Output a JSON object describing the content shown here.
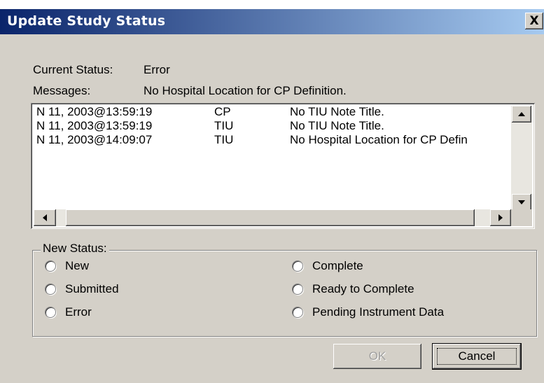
{
  "window": {
    "title": "Update Study Status",
    "close_glyph": "X"
  },
  "status": {
    "current_label": "Current Status:",
    "current_value": "Error",
    "messages_label": "Messages:",
    "messages_value": "No Hospital Location for CP Definition."
  },
  "message_list": {
    "rows": [
      {
        "datetime": "N 11, 2003@13:59:19",
        "source": "CP",
        "message": "No TIU Note Title."
      },
      {
        "datetime": "N 11, 2003@13:59:19",
        "source": "TIU",
        "message": "No TIU Note Title."
      },
      {
        "datetime": "N 11, 2003@14:09:07",
        "source": "TIU",
        "message": "No Hospital Location for CP Defin"
      }
    ]
  },
  "new_status": {
    "legend": "New Status:",
    "options": [
      {
        "label": "New",
        "selected": false
      },
      {
        "label": "Submitted",
        "selected": false
      },
      {
        "label": "Error",
        "selected": false
      },
      {
        "label": "Complete",
        "selected": false
      },
      {
        "label": "Ready to Complete",
        "selected": false
      },
      {
        "label": "Pending Instrument Data",
        "selected": false
      }
    ]
  },
  "buttons": {
    "ok_label": "OK",
    "cancel_label": "Cancel"
  },
  "icons": {
    "scroll_up": "scroll-up-icon",
    "scroll_down": "scroll-down-icon",
    "scroll_left": "scroll-left-icon",
    "scroll_right": "scroll-right-icon"
  },
  "colors": {
    "titlebar_start": "#0a246a",
    "titlebar_end": "#a6caf0",
    "dialog_bg": "#d4d0c8"
  }
}
